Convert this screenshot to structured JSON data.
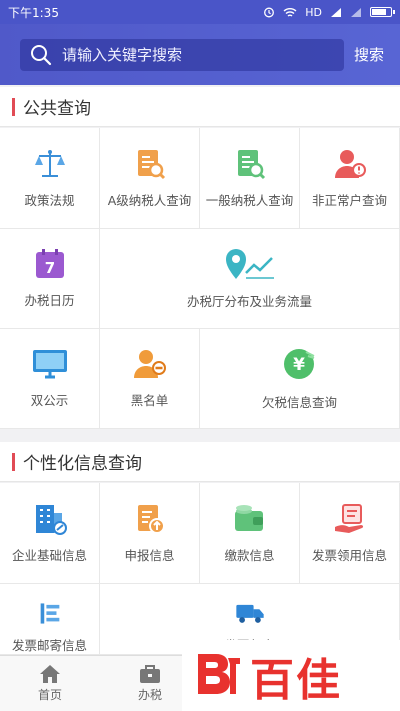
{
  "status_bar": {
    "time": "下午1:35",
    "network": "HD"
  },
  "search": {
    "placeholder": "请输入关键字搜索",
    "button_label": "搜索"
  },
  "sections": [
    {
      "title": "公共查询",
      "items": [
        {
          "label": "政策法规",
          "icon": "scales-icon"
        },
        {
          "label": "A级纳税人查询",
          "icon": "document-search-icon"
        },
        {
          "label": "一般纳税人查询",
          "icon": "document-search-icon"
        },
        {
          "label": "非正常户查询",
          "icon": "person-alert-icon"
        },
        {
          "label": "办税日历",
          "icon": "calendar-icon",
          "day": "7"
        },
        {
          "label": "办税厅分布及业务流量",
          "icon": "map-pin-chart-icon"
        },
        {
          "label": "双公示",
          "icon": "monitor-icon"
        },
        {
          "label": "黑名单",
          "icon": "person-blocked-icon"
        },
        {
          "label": "欠税信息查询",
          "icon": "yen-coin-icon",
          "symbol": "¥"
        }
      ]
    },
    {
      "title": "个性化信息查询",
      "items": [
        {
          "label": "企业基础信息",
          "icon": "building-icon"
        },
        {
          "label": "申报信息",
          "icon": "document-upload-icon"
        },
        {
          "label": "缴款信息",
          "icon": "wallet-icon"
        },
        {
          "label": "发票领用信息",
          "icon": "hand-invoice-icon"
        },
        {
          "label": "发票邮寄信息",
          "icon": "list-icon"
        },
        {
          "label": "发票邮寄",
          "icon": "truck-icon"
        }
      ]
    }
  ],
  "tabbar": [
    {
      "label": "首页",
      "icon": "home-icon"
    },
    {
      "label": "办税",
      "icon": "briefcase-icon"
    }
  ],
  "watermark": {
    "text": "百佳"
  },
  "colors": {
    "header": "#5059c9",
    "accent_red": "#e14b55"
  }
}
